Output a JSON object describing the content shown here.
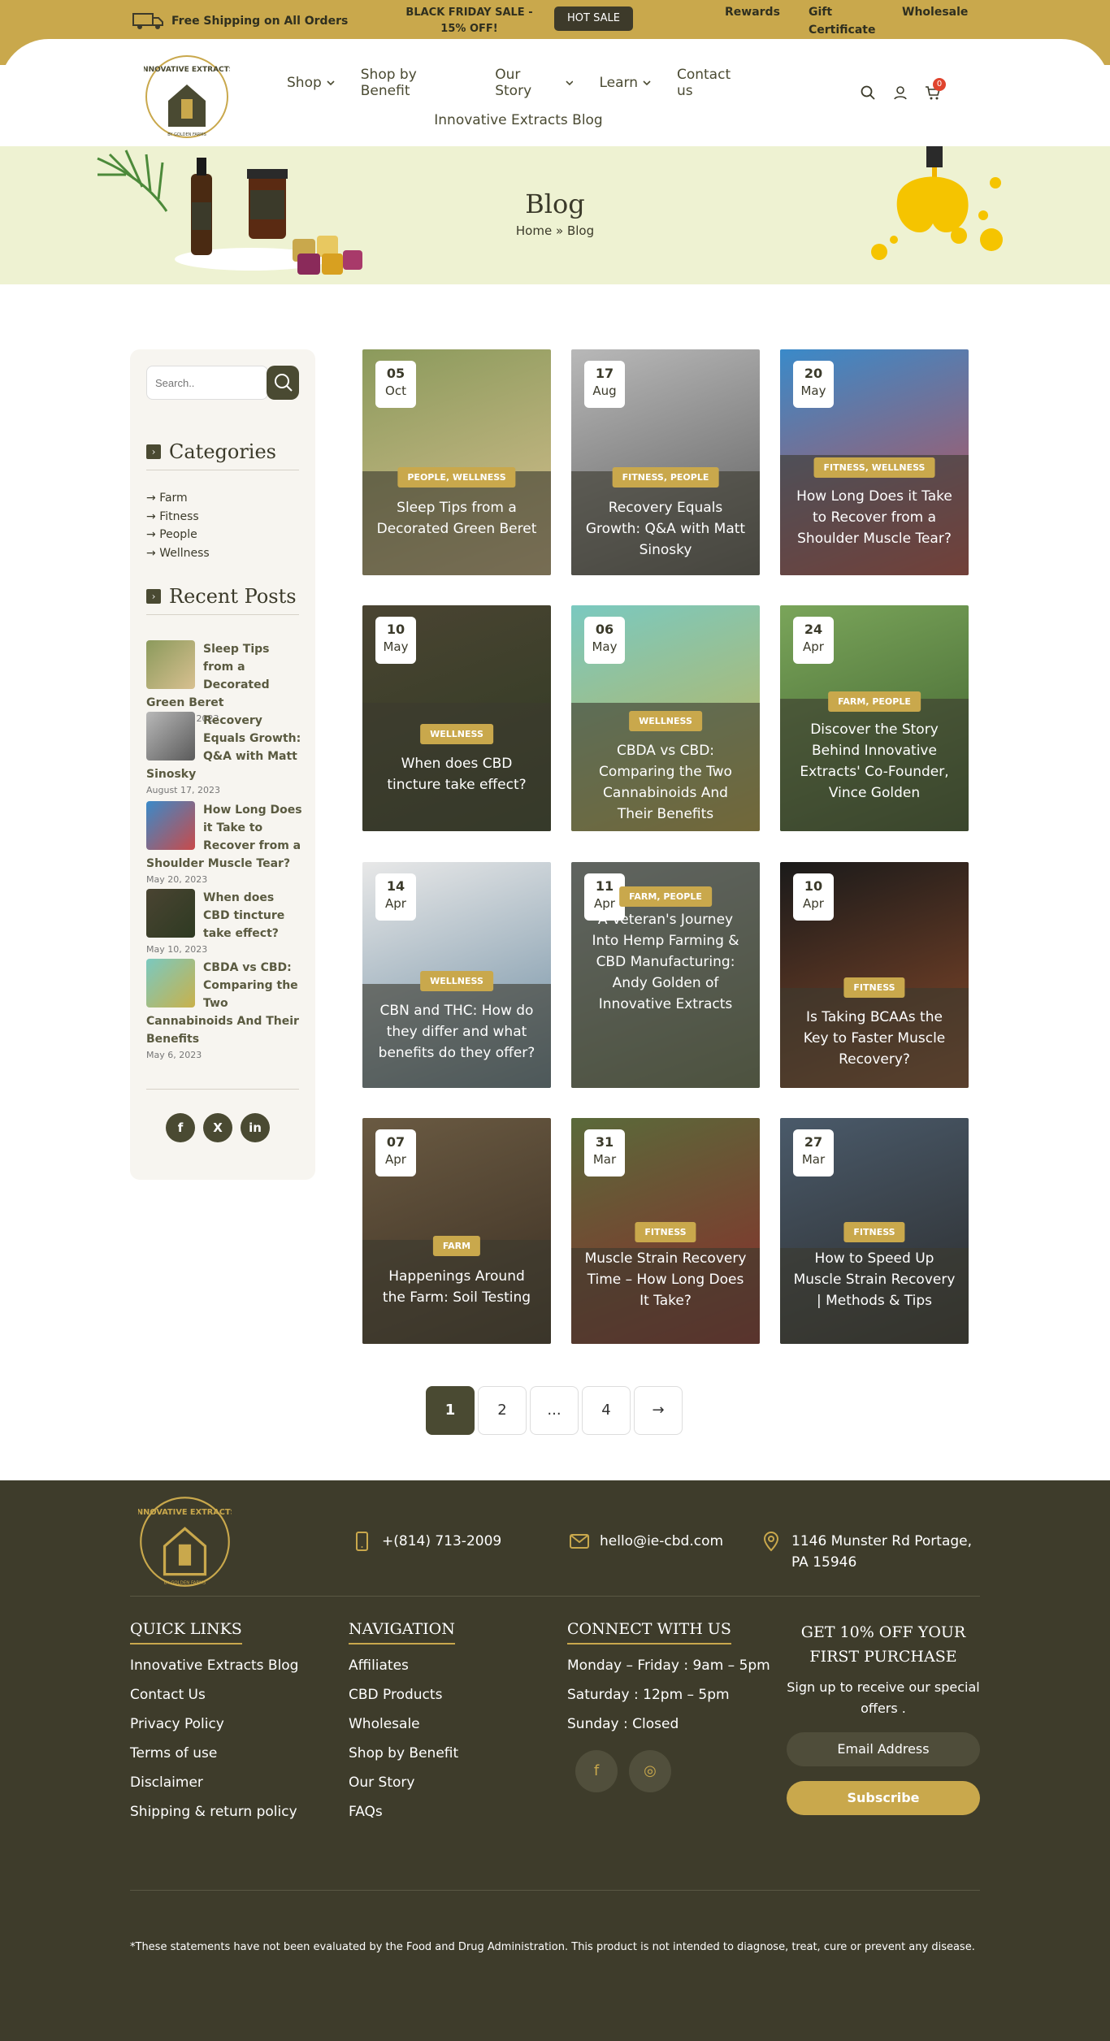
{
  "topbar": {
    "shipping": "Free Shipping on All Orders",
    "promo": "BLACK FRIDAY SALE - 15% OFF!",
    "hot_sale": "HOT SALE",
    "links": [
      "Rewards",
      "Gift Certificate",
      "Wholesale"
    ]
  },
  "header": {
    "logo_text": "INNOVATIVE EXTRACTS",
    "logo_sub": "BY GOLDEN FARMS",
    "nav": [
      "Shop",
      "Shop by Benefit",
      "Our Story",
      "Learn",
      "Contact us"
    ],
    "nav_blog": "Innovative Extracts Blog",
    "cart_count": "0"
  },
  "hero": {
    "title": "Blog",
    "crumb_home": "Home",
    "crumb_sep": "»",
    "crumb_current": "Blog"
  },
  "sidebar": {
    "search_placeholder": "Search..",
    "categories_title": "Categories",
    "categories": [
      "Farm",
      "Fitness",
      "People",
      "Wellness"
    ],
    "recent_title": "Recent Posts",
    "recent": [
      {
        "title": "Sleep Tips from a Decorated Green Beret",
        "date": "October 5, 2023"
      },
      {
        "title": "Recovery Equals Growth: Q&A with Matt Sinosky",
        "date": "August 17, 2023"
      },
      {
        "title": "How Long Does it Take to Recover from a Shoulder Muscle Tear?",
        "date": "May 20, 2023"
      },
      {
        "title": "When does CBD tincture take effect?",
        "date": "May 10, 2023"
      },
      {
        "title": "CBDA vs CBD: Comparing the Two Cannabinoids And Their Benefits",
        "date": "May 6, 2023"
      }
    ],
    "social": [
      "f",
      "X",
      "in"
    ]
  },
  "posts": [
    {
      "day": "05",
      "mon": "Oct",
      "tag": "PEOPLE, WELLNESS",
      "title": "Sleep Tips from a Decorated Green Beret",
      "color1": "#8b9a5c",
      "color2": "#d8c090"
    },
    {
      "day": "17",
      "mon": "Aug",
      "tag": "FITNESS, PEOPLE",
      "title": "Recovery Equals Growth: Q&A with Matt Sinosky",
      "color1": "#b8b8b8",
      "color2": "#5a5a5a"
    },
    {
      "day": "20",
      "mon": "May",
      "tag": "FITNESS, WELLNESS",
      "title": "How Long Does it Take to Recover from a Shoulder Muscle Tear?",
      "color1": "#3a8ac9",
      "color2": "#c94a4a"
    },
    {
      "day": "10",
      "mon": "May",
      "tag": "WELLNESS",
      "title": "When does CBD tincture take effect?",
      "color1": "#4a4432",
      "color2": "#2e3a22"
    },
    {
      "day": "06",
      "mon": "May",
      "tag": "WELLNESS",
      "title": "CBDA vs CBD: Comparing the Two Cannabinoids And Their Benefits",
      "color1": "#7ac9c0",
      "color2": "#c9b14a"
    },
    {
      "day": "24",
      "mon": "Apr",
      "tag": "FARM, PEOPLE",
      "title": "Discover the Story Behind Innovative Extracts' Co-Founder, Vince Golden",
      "color1": "#7aa55a",
      "color2": "#3a5a2a"
    },
    {
      "day": "14",
      "mon": "Apr",
      "tag": "WELLNESS",
      "title": "CBN and THC: How do they differ and what benefits do they offer?",
      "color1": "#e8e8e8",
      "color2": "#6a8aa0"
    },
    {
      "day": "11",
      "mon": "Apr",
      "tag": "FARM, PEOPLE",
      "title": "A Veteran's Journey Into Hemp Farming & CBD Manufacturing: Andy Golden of Innovative Extracts",
      "color1": "#9aa8b0",
      "color2": "#6a7a5a"
    },
    {
      "day": "10",
      "mon": "Apr",
      "tag": "FITNESS",
      "title": "Is Taking BCAAs the Key to Faster Muscle Recovery?",
      "color1": "#1a1a1a",
      "color2": "#8a4a2a"
    },
    {
      "day": "07",
      "mon": "Apr",
      "tag": "FARM",
      "title": "Happenings Around the Farm: Soil Testing",
      "color1": "#6a5a42",
      "color2": "#3a2e22"
    },
    {
      "day": "31",
      "mon": "Mar",
      "tag": "FITNESS",
      "title": "Muscle Strain Recovery Time – How Long Does It Take?",
      "color1": "#5a6a3a",
      "color2": "#8a2a2a"
    },
    {
      "day": "27",
      "mon": "Mar",
      "tag": "FITNESS",
      "title": "How to Speed Up Muscle Strain Recovery | Methods & Tips",
      "color1": "#4a5a6a",
      "color2": "#2a2a2a"
    }
  ],
  "pagination": [
    "1",
    "2",
    "...",
    "4",
    "→"
  ],
  "footer": {
    "phone": "+(814) 713-2009",
    "email": "hello@ie-cbd.com",
    "address": "1146 Munster Rd Portage, PA 15946",
    "quick_title": "QUICK LINKS",
    "quick": [
      "Innovative Extracts Blog",
      "Contact Us",
      "Privacy Policy",
      "Terms of use",
      "Disclaimer",
      "Shipping & return policy"
    ],
    "nav_title": "NAVIGATION",
    "nav": [
      "Affiliates",
      "CBD Products",
      "Wholesale",
      "Shop by Benefit",
      "Our Story",
      "FAQs"
    ],
    "connect_title": "CONNECT WITH US",
    "hours": [
      "Monday – Friday : 9am – 5pm",
      "Saturday : 12pm – 5pm",
      "Sunday : Closed"
    ],
    "offer_title": "GET 10% OFF YOUR FIRST PURCHASE",
    "offer_text": "Sign up to receive our special offers .",
    "email_placeholder": "Email Address",
    "subscribe": "Subscribe",
    "disclaimer": "*These statements have not been evaluated by the Food and Drug Administration. This product is not intended to diagnose, treat, cure or prevent any disease."
  },
  "colors": {
    "olive": "#4a4a32",
    "gold": "#c9a84c",
    "footer": "#3e3c2b",
    "hero": "#eef2d2"
  }
}
